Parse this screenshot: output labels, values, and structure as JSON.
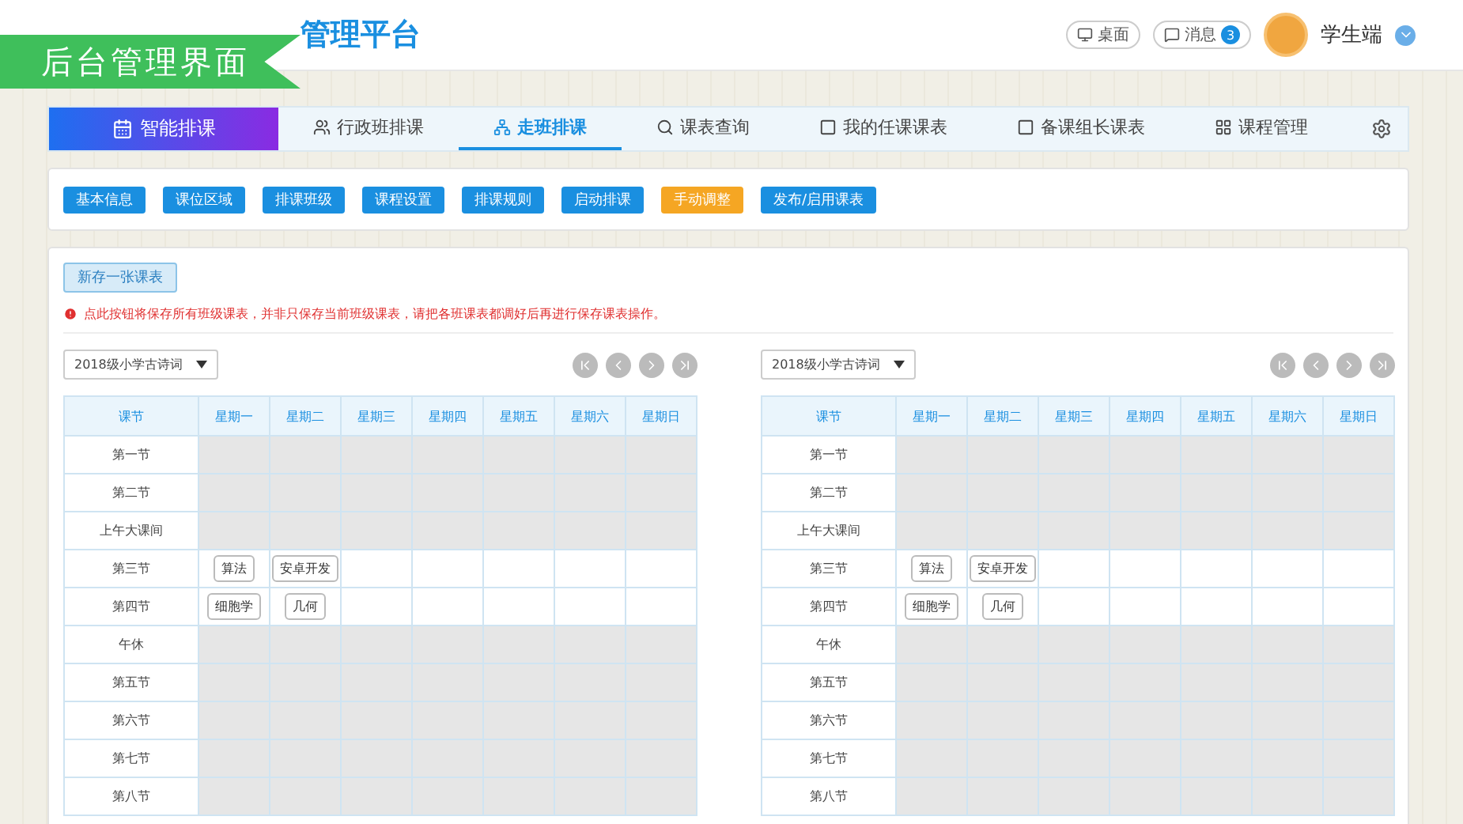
{
  "banner": {
    "text": "后台管理界面"
  },
  "header": {
    "title": "管理平台",
    "desktop": "桌面",
    "messages": "消息",
    "message_count": "3",
    "user": "学生端"
  },
  "nav": {
    "brand": "智能排课",
    "tabs": [
      {
        "label": "行政班排课",
        "selected": false
      },
      {
        "label": "走班排课",
        "selected": true
      },
      {
        "label": "课表查询",
        "selected": false
      },
      {
        "label": "我的任课课表",
        "selected": false
      },
      {
        "label": "备课组长课表",
        "selected": false
      },
      {
        "label": "课程管理",
        "selected": false
      }
    ]
  },
  "steps": [
    {
      "label": "基本信息",
      "selected": false
    },
    {
      "label": "课位区域",
      "selected": false
    },
    {
      "label": "排课班级",
      "selected": false
    },
    {
      "label": "课程设置",
      "selected": false
    },
    {
      "label": "排课规则",
      "selected": false
    },
    {
      "label": "启动排课",
      "selected": false
    },
    {
      "label": "手动调整",
      "selected": true
    },
    {
      "label": "发布/启用课表",
      "selected": false
    }
  ],
  "save_button": "新存一张课表",
  "warning": "点此按钮将保存所有班级课表，并非只保存当前班级课表，请把各班课表都调好后再进行保存课表操作。",
  "timetables": [
    {
      "class_select": "2018级小学古诗词",
      "columns": [
        "课节",
        "星期一",
        "星期二",
        "星期三",
        "星期四",
        "星期五",
        "星期六",
        "星期日"
      ],
      "rows": [
        {
          "label": "第一节",
          "open": false,
          "courses": []
        },
        {
          "label": "第二节",
          "open": false,
          "courses": []
        },
        {
          "label": "上午大课间",
          "open": false,
          "courses": []
        },
        {
          "label": "第三节",
          "open": true,
          "courses": [
            "算法",
            "安卓开发"
          ]
        },
        {
          "label": "第四节",
          "open": true,
          "courses": [
            "细胞学",
            "几何"
          ]
        },
        {
          "label": "午休",
          "open": false,
          "courses": []
        },
        {
          "label": "第五节",
          "open": false,
          "courses": []
        },
        {
          "label": "第六节",
          "open": false,
          "courses": []
        },
        {
          "label": "第七节",
          "open": false,
          "courses": []
        },
        {
          "label": "第八节",
          "open": false,
          "courses": []
        }
      ]
    },
    {
      "class_select": "2018级小学古诗词",
      "columns": [
        "课节",
        "星期一",
        "星期二",
        "星期三",
        "星期四",
        "星期五",
        "星期六",
        "星期日"
      ],
      "rows": [
        {
          "label": "第一节",
          "open": false,
          "courses": []
        },
        {
          "label": "第二节",
          "open": false,
          "courses": []
        },
        {
          "label": "上午大课间",
          "open": false,
          "courses": []
        },
        {
          "label": "第三节",
          "open": true,
          "courses": [
            "算法",
            "安卓开发"
          ]
        },
        {
          "label": "第四节",
          "open": true,
          "courses": [
            "细胞学",
            "几何"
          ]
        },
        {
          "label": "午休",
          "open": false,
          "courses": []
        },
        {
          "label": "第五节",
          "open": false,
          "courses": []
        },
        {
          "label": "第六节",
          "open": false,
          "courses": []
        },
        {
          "label": "第七节",
          "open": false,
          "courses": []
        },
        {
          "label": "第八节",
          "open": false,
          "courses": []
        }
      ]
    }
  ]
}
